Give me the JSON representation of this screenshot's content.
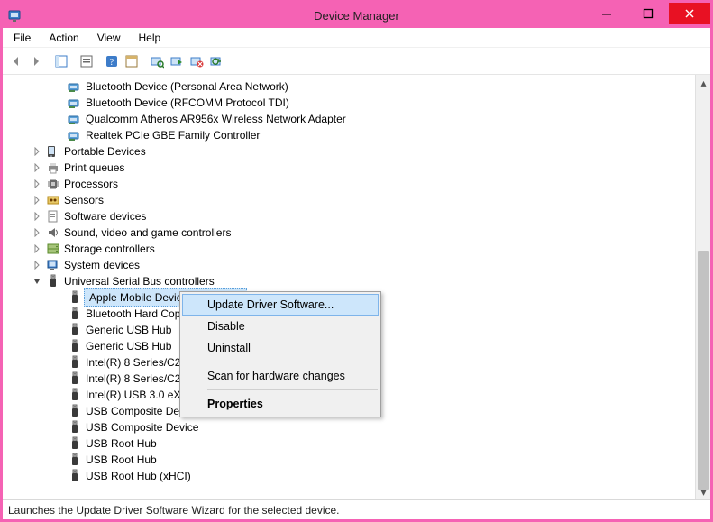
{
  "window": {
    "title": "Device Manager"
  },
  "menu": [
    "File",
    "Action",
    "View",
    "Help"
  ],
  "tree": [
    {
      "depth": 2,
      "exp": "none",
      "icon": "net",
      "label": "Bluetooth Device (Personal Area Network)"
    },
    {
      "depth": 2,
      "exp": "none",
      "icon": "net",
      "label": "Bluetooth Device (RFCOMM Protocol TDI)"
    },
    {
      "depth": 2,
      "exp": "none",
      "icon": "net",
      "label": "Qualcomm Atheros AR956x Wireless Network Adapter"
    },
    {
      "depth": 2,
      "exp": "none",
      "icon": "net",
      "label": "Realtek PCIe GBE Family Controller"
    },
    {
      "depth": 1,
      "exp": "closed",
      "icon": "portable",
      "label": "Portable Devices"
    },
    {
      "depth": 1,
      "exp": "closed",
      "icon": "printer",
      "label": "Print queues"
    },
    {
      "depth": 1,
      "exp": "closed",
      "icon": "cpu",
      "label": "Processors"
    },
    {
      "depth": 1,
      "exp": "closed",
      "icon": "sensor",
      "label": "Sensors"
    },
    {
      "depth": 1,
      "exp": "closed",
      "icon": "soft",
      "label": "Software devices"
    },
    {
      "depth": 1,
      "exp": "closed",
      "icon": "sound",
      "label": "Sound, video and game controllers"
    },
    {
      "depth": 1,
      "exp": "closed",
      "icon": "storage",
      "label": "Storage controllers"
    },
    {
      "depth": 1,
      "exp": "closed",
      "icon": "system",
      "label": "System devices"
    },
    {
      "depth": 1,
      "exp": "open",
      "icon": "usb",
      "label": "Universal Serial Bus controllers"
    },
    {
      "depth": 2,
      "exp": "none",
      "icon": "usb",
      "label": "Apple Mobile Device USB Driver",
      "selected": true
    },
    {
      "depth": 2,
      "exp": "none",
      "icon": "usb",
      "label": "Bluetooth Hard Copy Cable Replacement Server"
    },
    {
      "depth": 2,
      "exp": "none",
      "icon": "usb",
      "label": "Generic USB Hub"
    },
    {
      "depth": 2,
      "exp": "none",
      "icon": "usb",
      "label": "Generic USB Hub"
    },
    {
      "depth": 2,
      "exp": "none",
      "icon": "usb",
      "label": "Intel(R) 8 Series/C220 Series USB EHCI #1 - 8C26"
    },
    {
      "depth": 2,
      "exp": "none",
      "icon": "usb",
      "label": "Intel(R) 8 Series/C220 Series USB EHCI #2 - 8C2D"
    },
    {
      "depth": 2,
      "exp": "none",
      "icon": "usb",
      "label": "Intel(R) USB 3.0 eXtensible Host Controller - 0100 (Microsoft)"
    },
    {
      "depth": 2,
      "exp": "none",
      "icon": "usb",
      "label": "USB Composite Device"
    },
    {
      "depth": 2,
      "exp": "none",
      "icon": "usb",
      "label": "USB Composite Device"
    },
    {
      "depth": 2,
      "exp": "none",
      "icon": "usb",
      "label": "USB Root Hub"
    },
    {
      "depth": 2,
      "exp": "none",
      "icon": "usb",
      "label": "USB Root Hub"
    },
    {
      "depth": 2,
      "exp": "none",
      "icon": "usb",
      "label": "USB Root Hub (xHCI)"
    }
  ],
  "contextMenu": {
    "items": [
      {
        "label": "Update Driver Software...",
        "hover": true
      },
      {
        "label": "Disable"
      },
      {
        "label": "Uninstall"
      },
      {
        "sep": true
      },
      {
        "label": "Scan for hardware changes"
      },
      {
        "sep": true
      },
      {
        "label": "Properties",
        "strong": true
      }
    ]
  },
  "status": "Launches the Update Driver Software Wizard for the selected device."
}
